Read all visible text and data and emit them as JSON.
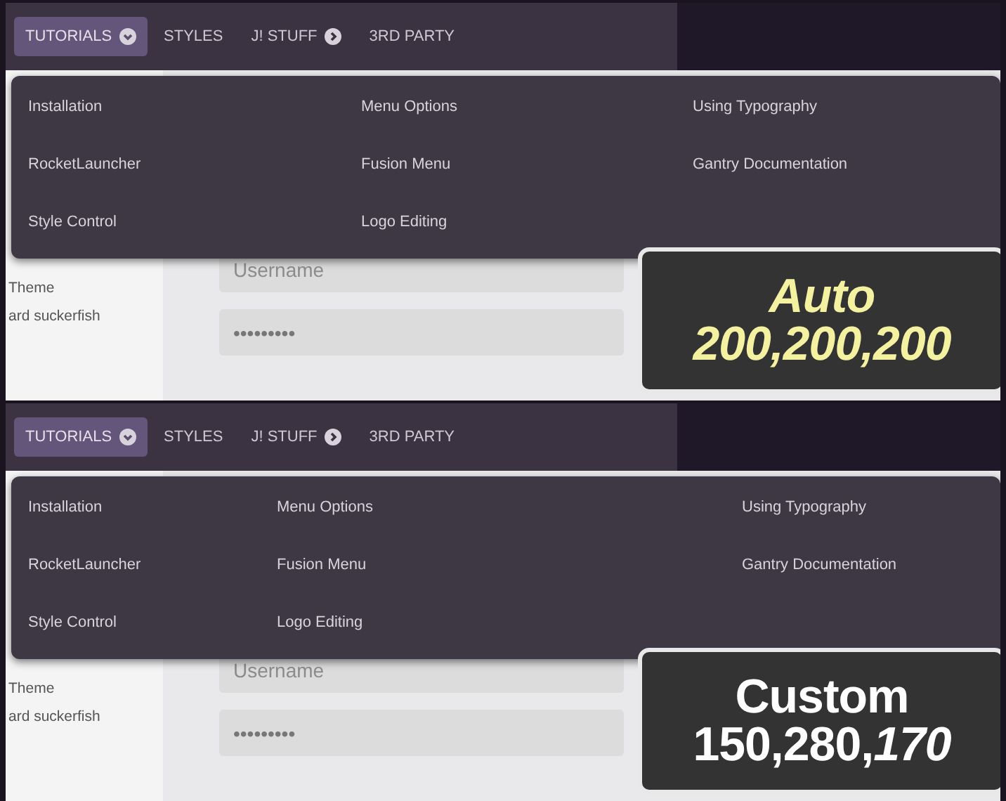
{
  "panels": [
    {
      "kind": "auto",
      "nav": [
        {
          "label": "TUTORIALS",
          "selected": true,
          "kind": "dropdown"
        },
        {
          "label": "STYLES",
          "selected": false,
          "kind": "plain"
        },
        {
          "label": "J! STUFF",
          "selected": false,
          "kind": "submenu"
        },
        {
          "label": "3RD PARTY",
          "selected": false,
          "kind": "plain"
        }
      ],
      "dropdown": {
        "columns": [
          [
            "Installation",
            "RocketLauncher",
            "Style Control"
          ],
          [
            "Menu Options",
            "Fusion Menu",
            "Logo Editing"
          ],
          [
            "Using Typography",
            "Gantry Documentation"
          ]
        ]
      },
      "sidebar": [
        "Theme",
        "ard suckerfish"
      ],
      "username": {
        "placeholder": "Username"
      },
      "password": {
        "value": "•••••••••"
      },
      "caption": [
        {
          "text": "Auto",
          "highlight": true
        },
        {
          "text": "200,200,200",
          "highlight": true
        }
      ]
    },
    {
      "kind": "custom",
      "nav": [
        {
          "label": "TUTORIALS",
          "selected": true,
          "kind": "dropdown"
        },
        {
          "label": "STYLES",
          "selected": false,
          "kind": "plain"
        },
        {
          "label": "J! STUFF",
          "selected": false,
          "kind": "submenu"
        },
        {
          "label": "3RD PARTY",
          "selected": false,
          "kind": "plain"
        }
      ],
      "dropdown": {
        "columns": [
          [
            "Installation",
            "RocketLauncher",
            "Style Control"
          ],
          [
            "Menu Options",
            "Fusion Menu",
            "Logo Editing"
          ],
          [
            "Using Typography",
            "Gantry Documentation"
          ]
        ]
      },
      "sidebar": [
        "Theme",
        "ard suckerfish"
      ],
      "username": {
        "placeholder": "Username"
      },
      "password": {
        "value": "•••••••••"
      },
      "caption": [
        {
          "text": "Custom",
          "highlight": false
        },
        {
          "text": "150,280,*170*",
          "highlight": false
        }
      ]
    }
  ]
}
